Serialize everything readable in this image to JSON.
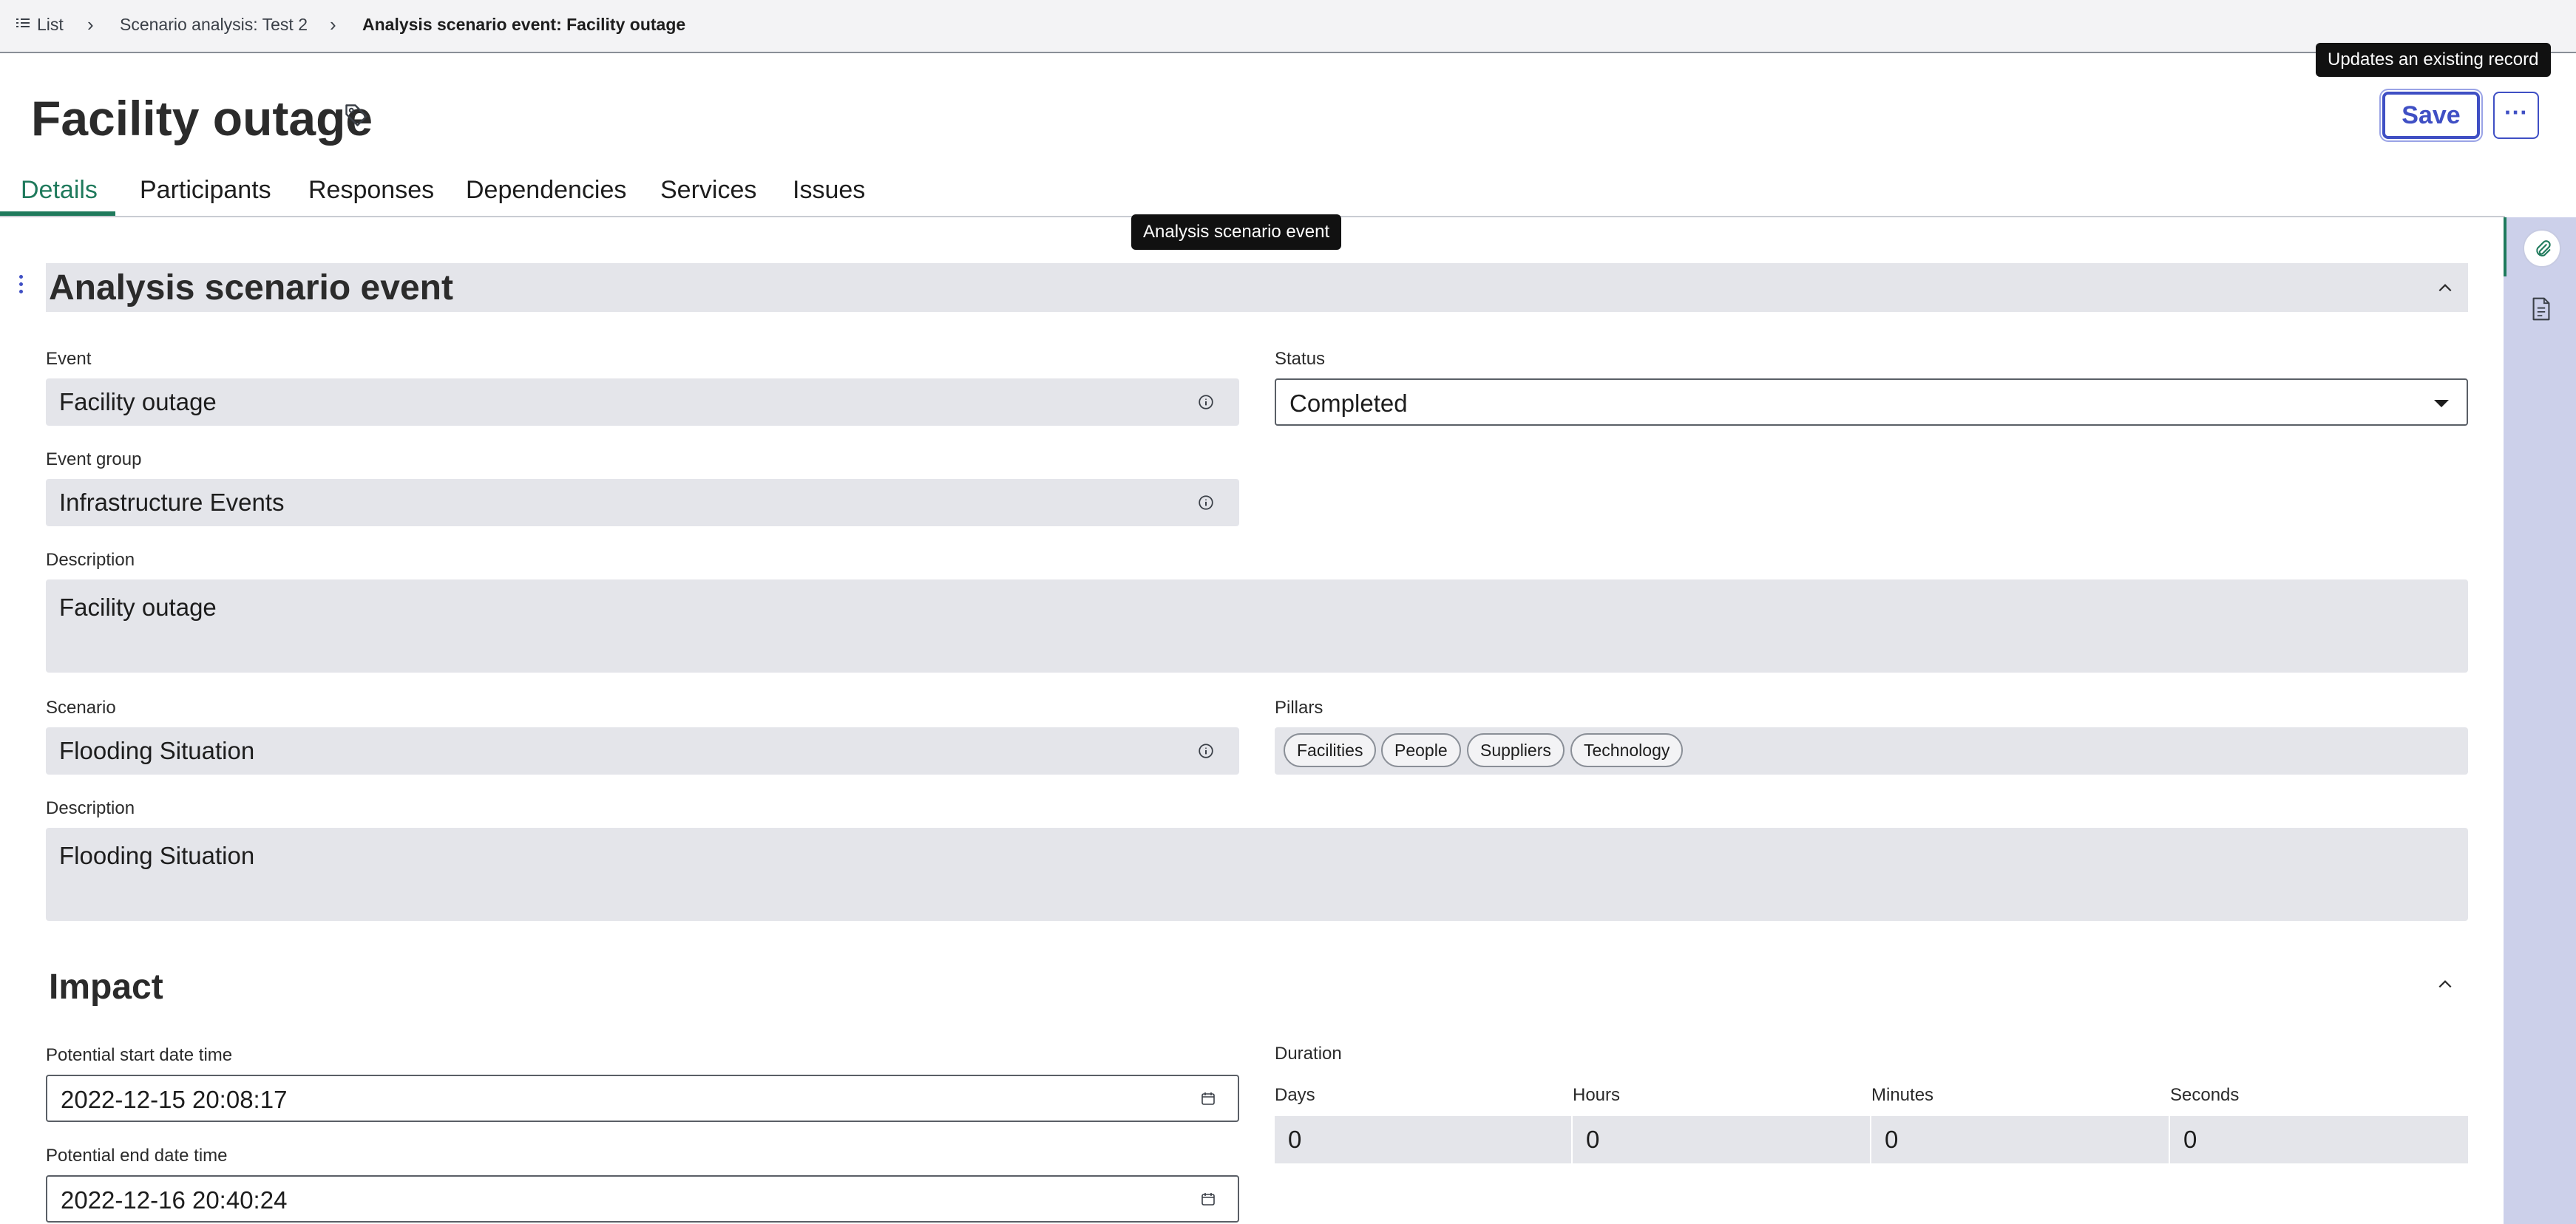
{
  "breadcrumb": {
    "list": "List",
    "parent": "Scenario analysis: Test 2",
    "current": "Analysis scenario event: Facility outage"
  },
  "header": {
    "title": "Facility outage",
    "save_label": "Save",
    "more_label": "···",
    "save_tooltip": "Updates an existing record"
  },
  "tabs": [
    "Details",
    "Participants",
    "Responses",
    "Dependencies",
    "Services",
    "Issues"
  ],
  "section_tooltip": "Analysis scenario event",
  "sections": {
    "event": {
      "title": "Analysis scenario event",
      "event_label": "Event",
      "event_value": "Facility outage",
      "status_label": "Status",
      "status_value": "Completed",
      "event_group_label": "Event group",
      "event_group_value": "Infrastructure Events",
      "description_label": "Description",
      "description_value": "Facility outage",
      "scenario_label": "Scenario",
      "scenario_value": "Flooding Situation",
      "pillars_label": "Pillars",
      "pillars": [
        "Facilities",
        "People",
        "Suppliers",
        "Technology"
      ],
      "scenario_description_label": "Description",
      "scenario_description_value": "Flooding Situation"
    },
    "impact": {
      "title": "Impact",
      "start_label": "Potential start date time",
      "start_value": "2022-12-15 20:08:17",
      "end_label": "Potential end date time",
      "end_value": "2022-12-16 20:40:24",
      "duration_label": "Duration",
      "days_label": "Days",
      "days_value": "0",
      "hours_label": "Hours",
      "hours_value": "0",
      "minutes_label": "Minutes",
      "minutes_value": "0",
      "seconds_label": "Seconds",
      "seconds_value": "0"
    }
  },
  "icons": {
    "list": "list-icon",
    "tag": "tag-icon",
    "info": "info-icon",
    "calendar": "calendar-icon",
    "attachment": "paperclip-icon",
    "document": "document-icon"
  },
  "colors": {
    "accent": "#3f4fc4",
    "tab_active": "#1f7a5c",
    "field_bg": "#e4e5ea",
    "rail_bg": "#ccd0ea"
  }
}
